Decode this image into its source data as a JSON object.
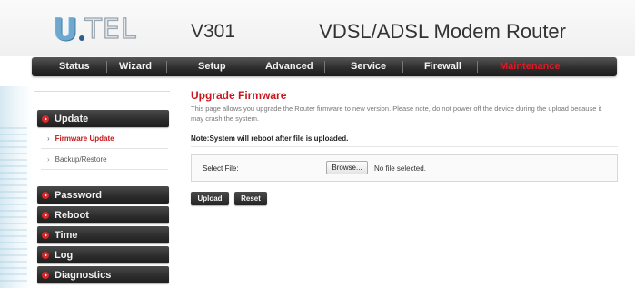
{
  "header": {
    "logo_first": "U",
    "logo_rest": "TEL",
    "model": "V301",
    "product": "VDSL/ADSL Modem Router"
  },
  "nav": {
    "items": [
      {
        "label": "Status"
      },
      {
        "label": "Wizard"
      },
      {
        "label": "Setup"
      },
      {
        "label": "Advanced"
      },
      {
        "label": "Service"
      },
      {
        "label": "Firewall"
      },
      {
        "label": "Maintenance"
      }
    ],
    "active": "Maintenance"
  },
  "sidebar": {
    "sections": [
      {
        "label": "Update"
      },
      {
        "label": "Password"
      },
      {
        "label": "Reboot"
      },
      {
        "label": "Time"
      },
      {
        "label": "Log"
      },
      {
        "label": "Diagnostics"
      }
    ],
    "sub_items": [
      {
        "label": "Firmware Update"
      },
      {
        "label": "Backup/Restore"
      }
    ],
    "active_sub": "Firmware Update"
  },
  "main": {
    "title": "Upgrade Firmware",
    "description": "This page allows you upgrade the Router firmware to new version. Please note, do not power off the device during the upload because it may crash the system.",
    "note": "Note:System will reboot after file is uploaded.",
    "file_label": "Select File:",
    "browse_label": "Browse...",
    "file_status": "No file selected.",
    "upload_label": "Upload",
    "reset_label": "Reset"
  },
  "colors": {
    "accent_red": "#c9161e",
    "nav_dark": "#2e2e2e",
    "logo_blue": "#6fa8cf"
  }
}
